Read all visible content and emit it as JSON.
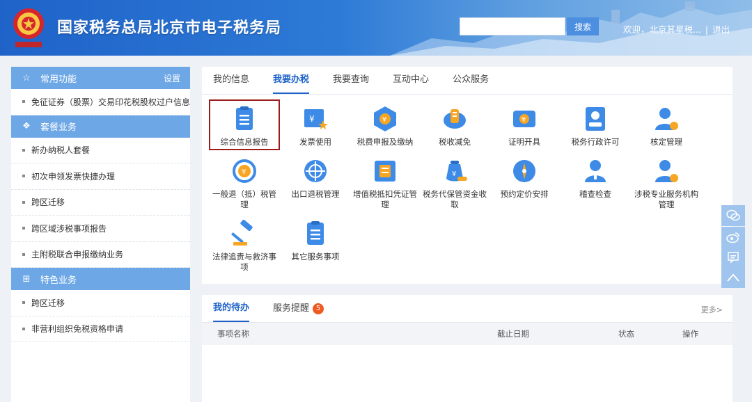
{
  "header": {
    "title": "国家税务总局北京市电子税务局",
    "search_placeholder": "",
    "search_label": "搜索",
    "welcome": "欢迎，北京其星税...",
    "separator": "|",
    "logout": "退出"
  },
  "sidebar": {
    "sections": [
      {
        "title": "常用功能",
        "icon": "star-icon",
        "setting": "设置",
        "items": [
          "免征证券（股票）交易印花税股权过户信息采"
        ]
      },
      {
        "title": "套餐业务",
        "icon": "layers-icon",
        "items": [
          "新办纳税人套餐",
          "初次申领发票快捷办理",
          "跨区迁移",
          "跨区域涉税事项报告",
          "主附税联合申报缴纳业务"
        ]
      },
      {
        "title": "特色业务",
        "icon": "grid-icon",
        "items": [
          "跨区迁移",
          "非营利组织免税资格申请"
        ]
      }
    ]
  },
  "main": {
    "tabs": [
      "我的信息",
      "我要办税",
      "我要查询",
      "互动中心",
      "公众服务"
    ],
    "active_tab": 1,
    "services": [
      {
        "label": "综合信息报告",
        "icon": "report-icon"
      },
      {
        "label": "发票使用",
        "icon": "invoice-icon"
      },
      {
        "label": "税费申报及缴纳",
        "icon": "declare-icon"
      },
      {
        "label": "税收减免",
        "icon": "reduction-icon"
      },
      {
        "label": "证明开具",
        "icon": "certificate-icon"
      },
      {
        "label": "税务行政许可",
        "icon": "license-icon"
      },
      {
        "label": "核定管理",
        "icon": "verify-icon"
      },
      {
        "label": "一般退（抵）税管理",
        "icon": "refund-icon"
      },
      {
        "label": "出口退税管理",
        "icon": "export-refund-icon"
      },
      {
        "label": "增值税抵扣凭证管理",
        "icon": "vat-icon"
      },
      {
        "label": "税务代保管资金收取",
        "icon": "fund-icon"
      },
      {
        "label": "预约定价安排",
        "icon": "pricing-icon"
      },
      {
        "label": "稽查检查",
        "icon": "inspection-icon"
      },
      {
        "label": "涉税专业服务机构管理",
        "icon": "agency-icon"
      },
      {
        "label": "法律追责与救济事项",
        "icon": "law-icon"
      },
      {
        "label": "其它服务事项",
        "icon": "other-icon"
      }
    ]
  },
  "todo": {
    "tabs": [
      {
        "label": "我的待办"
      },
      {
        "label": "服务提醒",
        "badge": "5"
      }
    ],
    "more": "更多>",
    "columns": [
      "事项名称",
      "截止日期",
      "状态",
      "操作"
    ]
  },
  "float_icons": [
    "wechat-icon",
    "weibo-icon",
    "message-icon",
    "back-to-top-icon"
  ]
}
